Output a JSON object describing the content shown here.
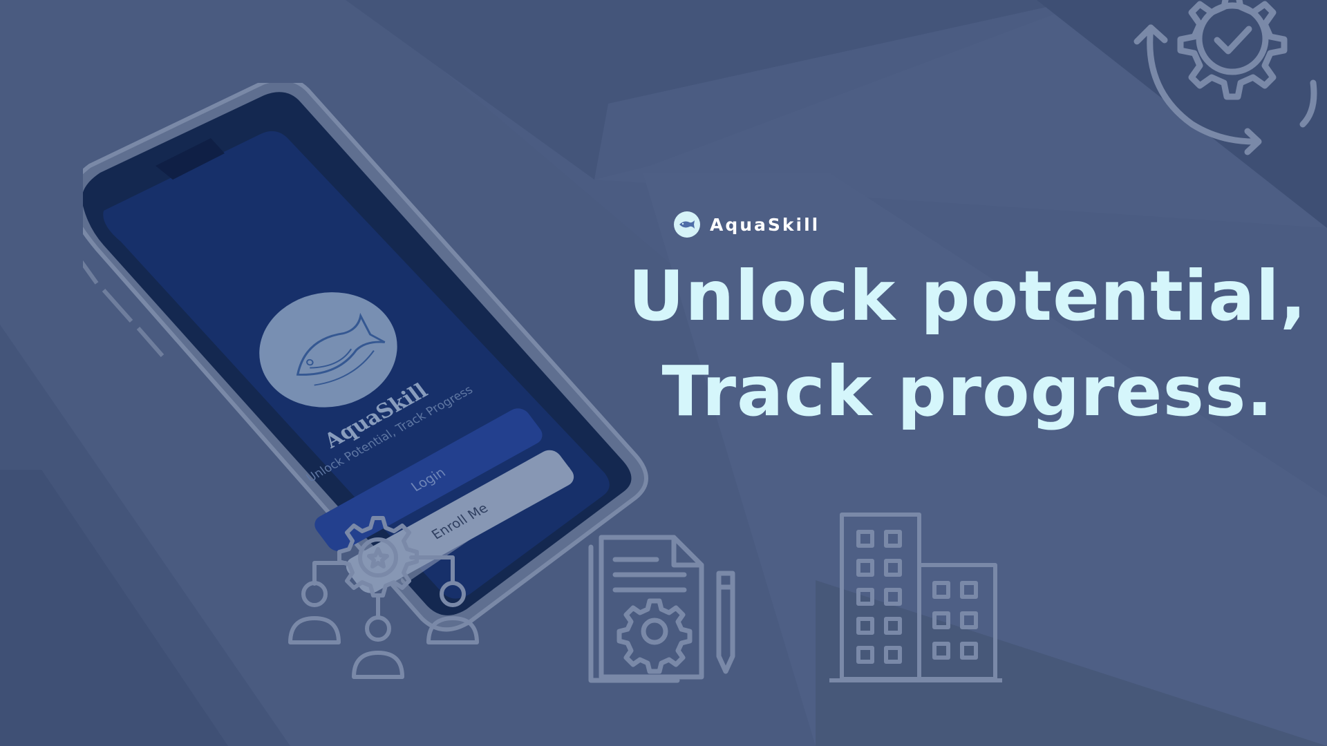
{
  "brand": {
    "name": "AquaSkill",
    "logo_icon": "fish-icon"
  },
  "headline": {
    "line1": "Unlock potential,",
    "line2": "Track progress."
  },
  "phone_screen": {
    "app_name": "AquaSkill",
    "tagline": "Unlock Potential, Track Progress",
    "login_label": "Login",
    "enroll_label": "Enroll Me",
    "logo_icon": "fish-icon"
  },
  "decor_icons": [
    "gear-check-cycle-icon",
    "team-gear-icon",
    "document-gear-pencil-icon",
    "buildings-icon"
  ],
  "colors": {
    "background": "#4b5c82",
    "headline": "#d5f6fb",
    "brand_text": "#ffffff",
    "icon_stroke": "#7a89a8",
    "login_button": "#23408e",
    "enroll_button": "#8797b4",
    "phone_screen": "#172e66"
  }
}
